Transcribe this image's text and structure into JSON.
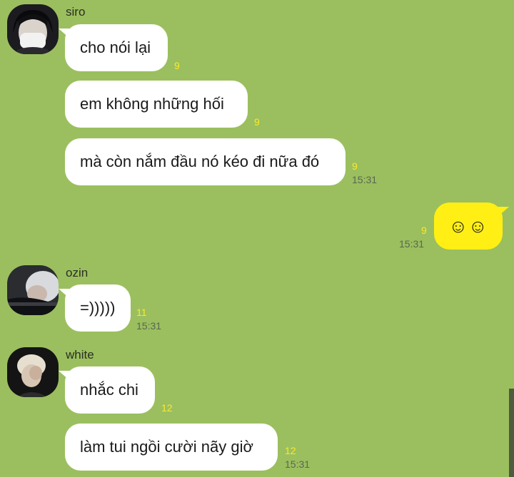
{
  "messages": [
    {
      "sender": "siro",
      "text": "cho nói lại",
      "unread": "9"
    },
    {
      "text": "em không những hối",
      "unread": "9"
    },
    {
      "text": "mà còn nắm đầu nó kéo đi nữa đó",
      "unread": "9",
      "time": "15:31"
    },
    {
      "mine": true,
      "text": "☺☺",
      "unread": "9",
      "time": "15:31"
    },
    {
      "sender": "ozin",
      "text": "=)))))",
      "unread": "11",
      "time": "15:31"
    },
    {
      "sender": "white",
      "text": "nhắc chi",
      "unread": "12"
    },
    {
      "text": "làm tui ngồi cười nãy giờ",
      "unread": "12",
      "time": "15:31"
    }
  ],
  "colors": {
    "background": "#9bbf5f",
    "incoming_bubble": "#ffffff",
    "outgoing_bubble": "#ffef14",
    "unread_count": "#fbe829"
  },
  "icons": {
    "avatar_siro": "avatar-masked-person-icon",
    "avatar_ozin": "avatar-resting-person-icon",
    "avatar_white": "avatar-hand-on-face-icon"
  }
}
